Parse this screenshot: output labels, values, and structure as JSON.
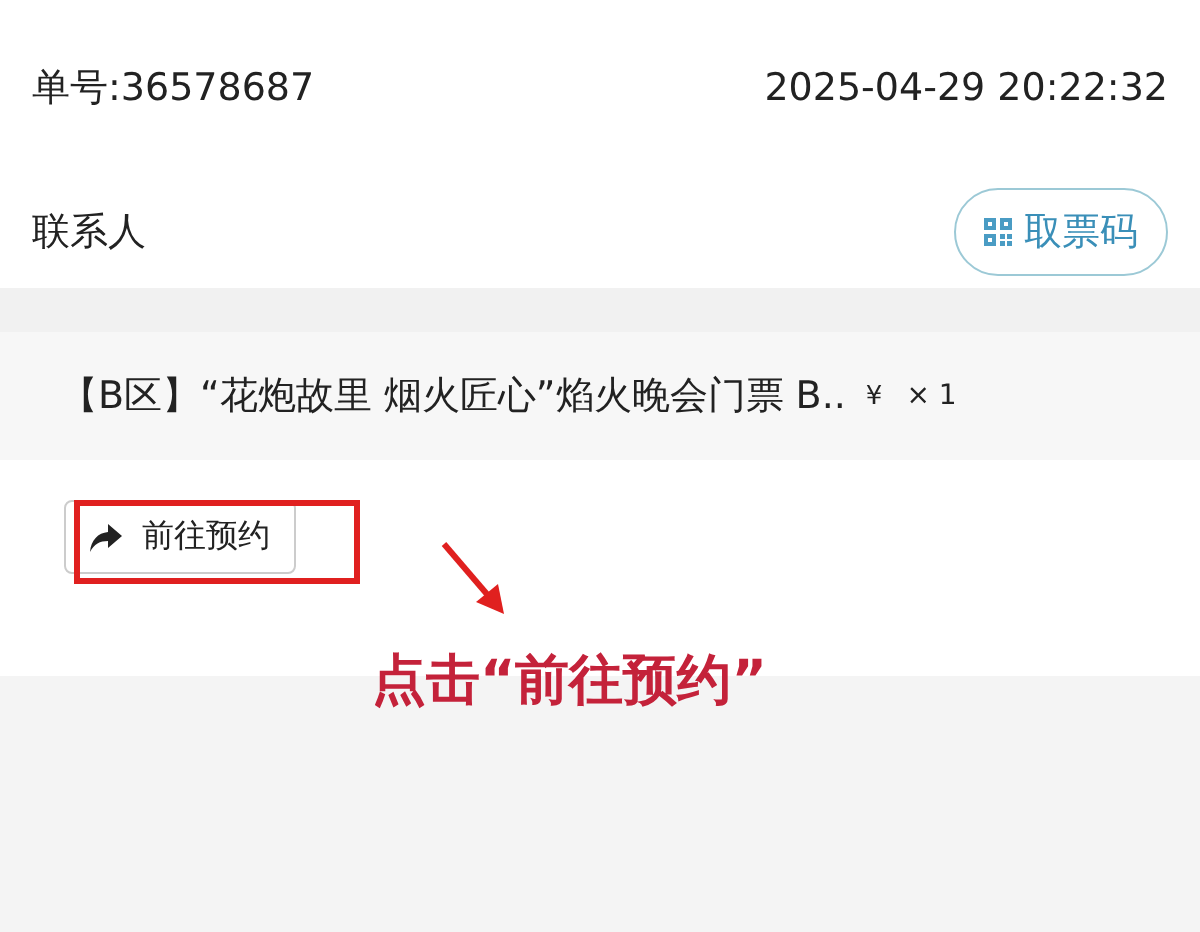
{
  "order": {
    "number": "单号:36578687",
    "time": "2025-04-29 20:22:32"
  },
  "contact": {
    "label": "联系人",
    "ticket_button": "取票码"
  },
  "item": {
    "title": "【B区】“花炮故里 烟火匠心”焰火晚会门票 B..",
    "currency": "¥",
    "quantity": "× 1"
  },
  "action": {
    "button": "前往预约",
    "highlighted": true
  },
  "annotation": {
    "caption": "点击“前往预约”"
  }
}
